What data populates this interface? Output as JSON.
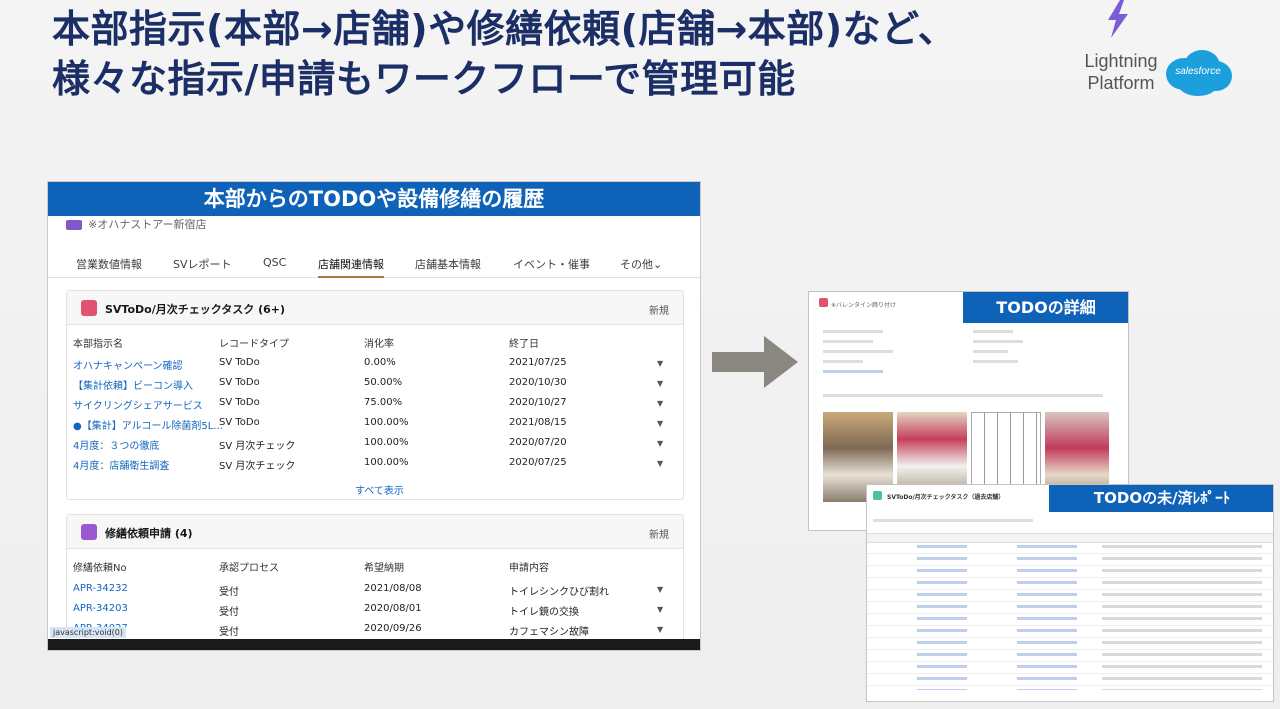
{
  "slide": {
    "title_line1": "本部指示(本部→店舗)や修繕依頼(店舗→本部)など、",
    "title_line2": "様々な指示/申請もワークフローで管理可能"
  },
  "brand": {
    "platform_line1": "Lightning",
    "platform_line2": "Platform",
    "logo_text": "salesforce",
    "bolt_color": "#7b5cd6",
    "cloud_color": "#1ba0dd"
  },
  "main_panel": {
    "banner": "本部からのTODOや設備修繕の履歴",
    "record_title": "※オハナストアー新宿店",
    "tabs": [
      "営業数値情報",
      "SVレポート",
      "QSC",
      "店舗関連情報",
      "店舗基本情報",
      "イベント・催事",
      "その他"
    ],
    "active_tab_index": 3,
    "todo_card": {
      "title": "SVToDo/月次チェックタスク (6+)",
      "new_label": "新規",
      "columns": [
        "本部指示名",
        "レコードタイプ",
        "消化率",
        "終了日"
      ],
      "rows": [
        [
          "オハナキャンペーン確認",
          "SV ToDo",
          "0.00%",
          "2021/07/25"
        ],
        [
          "【集計依頼】ビーコン導入",
          "SV ToDo",
          "50.00%",
          "2020/10/30"
        ],
        [
          "サイクリングシェアサービス",
          "SV ToDo",
          "75.00%",
          "2020/10/27"
        ],
        [
          "●【集計】アルコール除菌剤5L...",
          "SV ToDo",
          "100.00%",
          "2021/08/15"
        ],
        [
          "4月度：３つの徹底",
          "SV 月次チェック",
          "100.00%",
          "2020/07/20"
        ],
        [
          "4月度：店舗衛生調査",
          "SV 月次チェック",
          "100.00%",
          "2020/07/25"
        ]
      ],
      "view_all": "すべて表示",
      "icon_color": "#e0526e"
    },
    "repair_card": {
      "title": "修繕依頼申請 (4)",
      "new_label": "新規",
      "columns": [
        "修繕依頼No",
        "承認プロセス",
        "希望納期",
        "申請内容"
      ],
      "rows": [
        [
          "APR-34232",
          "受付",
          "2021/08/08",
          "トイレシンクひび割れ"
        ],
        [
          "APR-34203",
          "受付",
          "2020/08/01",
          "トイレ鏡の交換"
        ],
        [
          "APR-34027",
          "受付",
          "2020/09/26",
          "カフェマシン故障"
        ]
      ],
      "icon_color": "#9b59d0"
    },
    "status_link": "javascript:void(0)"
  },
  "detail_shot": {
    "banner": "TODOの詳細",
    "record_name": "※バレンタイン飾り付け"
  },
  "report_shot": {
    "banner": "TODOの未/済ﾚﾎﾟｰﾄ",
    "report_title": "SVToDo/月次チェックタスク（過去店舗）"
  },
  "colors": {
    "title": "#1b2f66",
    "banner": "#0e62b8",
    "link": "#1166c0",
    "arrow": "#8a8680"
  }
}
